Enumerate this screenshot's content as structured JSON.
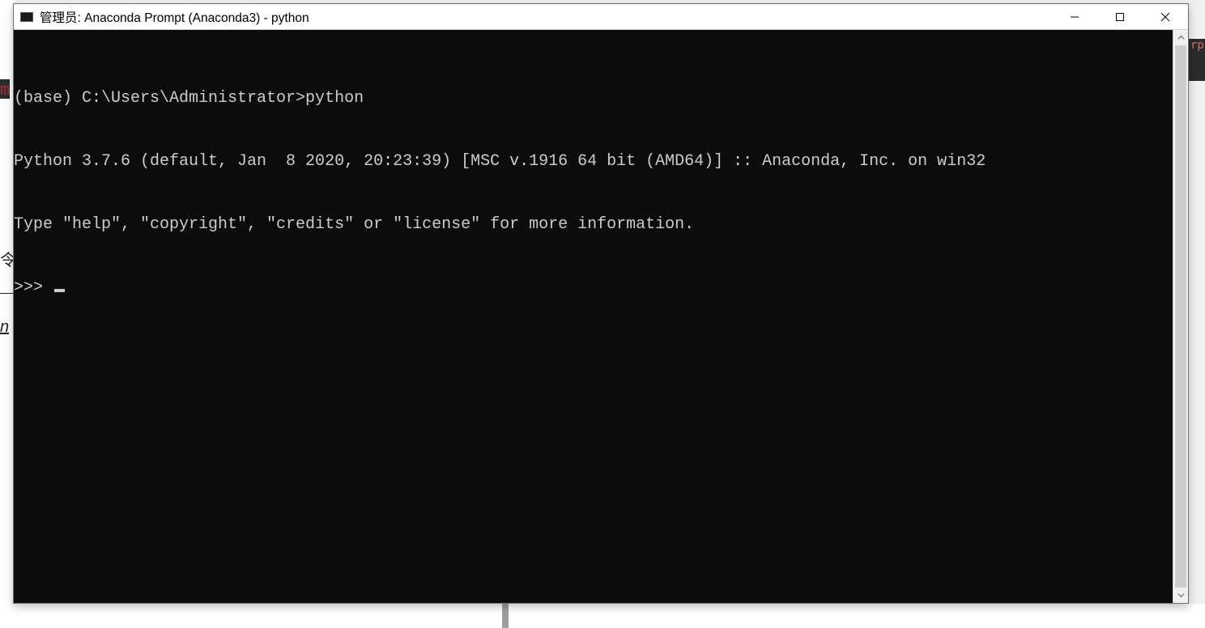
{
  "background_hints": {
    "h1": "令",
    "h2": "n",
    "red": "m"
  },
  "window": {
    "title": "管理员: Anaconda Prompt (Anaconda3) - python"
  },
  "terminal": {
    "lines": {
      "l0": "",
      "l1": "(base) C:\\Users\\Administrator>python",
      "l2": "Python 3.7.6 (default, Jan  8 2020, 20:23:39) [MSC v.1916 64 bit (AMD64)] :: Anaconda, Inc. on win32",
      "l3": "Type \"help\", \"copyright\", \"credits\" or \"license\" for more information.",
      "prompt": ">>> "
    }
  },
  "behind_strip": {
    "text": "rp"
  }
}
